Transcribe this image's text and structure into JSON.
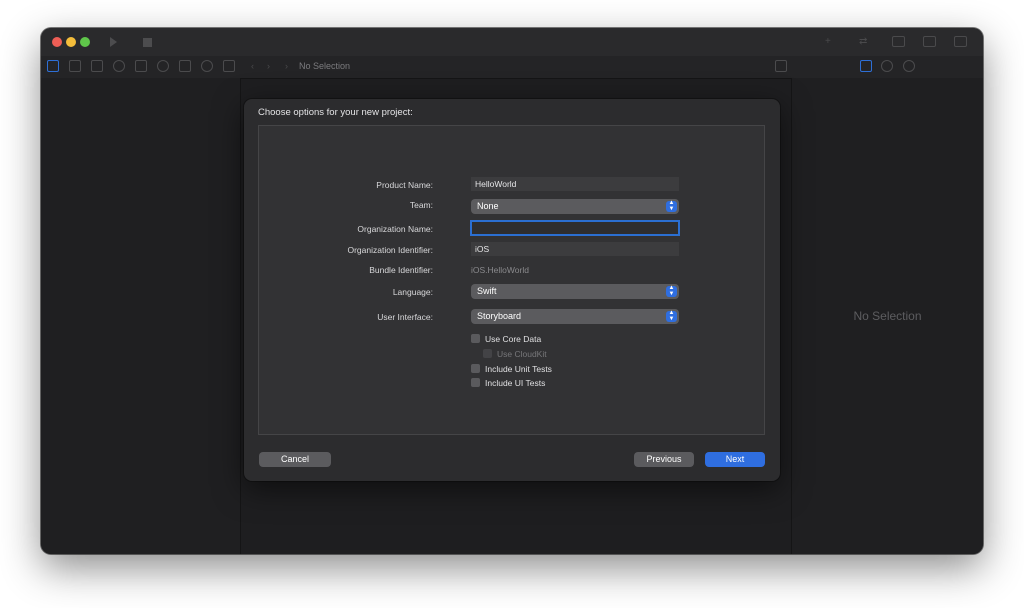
{
  "window": {
    "breadcrumb_no_selection": "No Selection",
    "inspector_no_selection": "No Selection"
  },
  "toolbar": {
    "icons": [
      "play-icon",
      "stop-icon",
      "library-icon",
      "code-review-icon",
      "layout-icon"
    ]
  },
  "navigator_icons": [
    "folder-icon",
    "source-control-icon",
    "symbol-icon",
    "search-icon",
    "issue-icon",
    "test-icon",
    "debug-icon",
    "breakpoint-icon",
    "report-icon"
  ],
  "sheet": {
    "title": "Choose options for your new project:",
    "fields": {
      "product_name": {
        "label": "Product Name:",
        "value": "HelloWorld"
      },
      "team": {
        "label": "Team:",
        "value": "None"
      },
      "organization_name": {
        "label": "Organization Name:",
        "value": ""
      },
      "organization_identifier": {
        "label": "Organization Identifier:",
        "value": "iOS"
      },
      "bundle_identifier": {
        "label": "Bundle Identifier:",
        "value": "iOS.HelloWorld"
      },
      "language": {
        "label": "Language:",
        "value": "Swift"
      },
      "user_interface": {
        "label": "User Interface:",
        "value": "Storyboard"
      }
    },
    "checkboxes": {
      "use_core_data": {
        "label": "Use Core Data",
        "checked": false
      },
      "use_cloudkit": {
        "label": "Use CloudKit",
        "checked": false,
        "enabled": false
      },
      "include_unit_tests": {
        "label": "Include Unit Tests",
        "checked": false
      },
      "include_ui_tests": {
        "label": "Include UI Tests",
        "checked": false
      }
    },
    "buttons": {
      "cancel": "Cancel",
      "previous": "Previous",
      "next": "Next"
    }
  },
  "colors": {
    "accent": "#2f6ee0",
    "window_bg": "#1e1e20",
    "sheet_bg": "#2c2c2e"
  }
}
